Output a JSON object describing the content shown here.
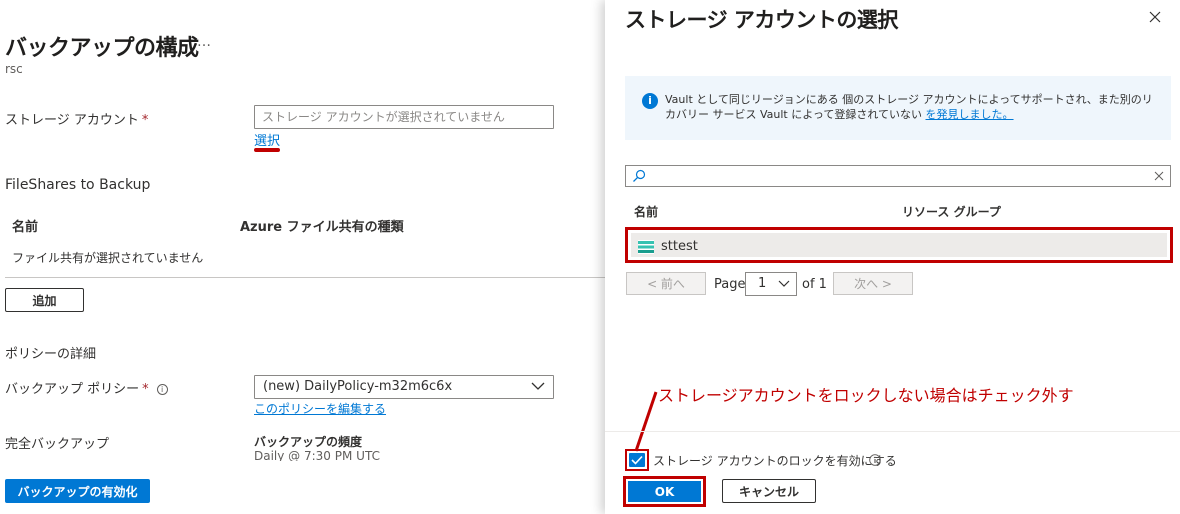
{
  "left": {
    "title": "バックアップの構成",
    "more": "…",
    "subtitle": "rsc",
    "storage_label": "ストレージ アカウント",
    "required_mark": "*",
    "storage_placeholder": "ストレージ アカウントが選択されていません",
    "select_link": "選択",
    "fileshares_title": "FileShares to Backup",
    "table_headers": [
      "名前",
      "Azure ファイル共有の種類"
    ],
    "empty_row": "ファイル共有が選択されていません",
    "add_button": "追加",
    "policy_section": "ポリシーの詳細",
    "policy_label": "バックアップ ポリシー",
    "policy_value": "(new) DailyPolicy-m32m6c6x",
    "edit_policy_link": "このポリシーを編集する",
    "full_backup_label": "完全バックアップ",
    "frequency_title": "バックアップの頻度",
    "frequency_value": "Daily @ 7:30 PM UTC",
    "enable_button": "バックアップの有効化"
  },
  "panel": {
    "title": "ストレージ アカウントの選択",
    "info_text": "Vault として同じリージョンにある 個のストレージ アカウントによってサポートされ、また別のリカバリー サービス Vault によって登録されていない",
    "info_link": "を発見しました。",
    "table_headers": [
      "名前",
      "リソース グループ"
    ],
    "rows": [
      {
        "name": "sttest",
        "resource_group": ""
      }
    ],
    "pager": {
      "prev": "< 前へ",
      "page_label": "Page",
      "page_value": "1",
      "of_label": "of 1",
      "next": "次へ >"
    },
    "annotation": "ストレージアカウントをロックしない場合はチェック外す",
    "lock_checkbox_label": "ストレージ アカウントのロックを有効にする",
    "lock_checked": true,
    "ok_button": "OK",
    "cancel_button": "キャンセル"
  },
  "colors": {
    "accent": "#0078d4",
    "highlight_red": "#c00000",
    "info_bg": "#eff6fc",
    "row_selected": "#edebe9"
  },
  "icons": [
    "more-icon",
    "info-icon",
    "chevron-down-icon",
    "close-icon",
    "search-icon",
    "clear-icon",
    "storage-account-icon",
    "checkmark-icon"
  ]
}
